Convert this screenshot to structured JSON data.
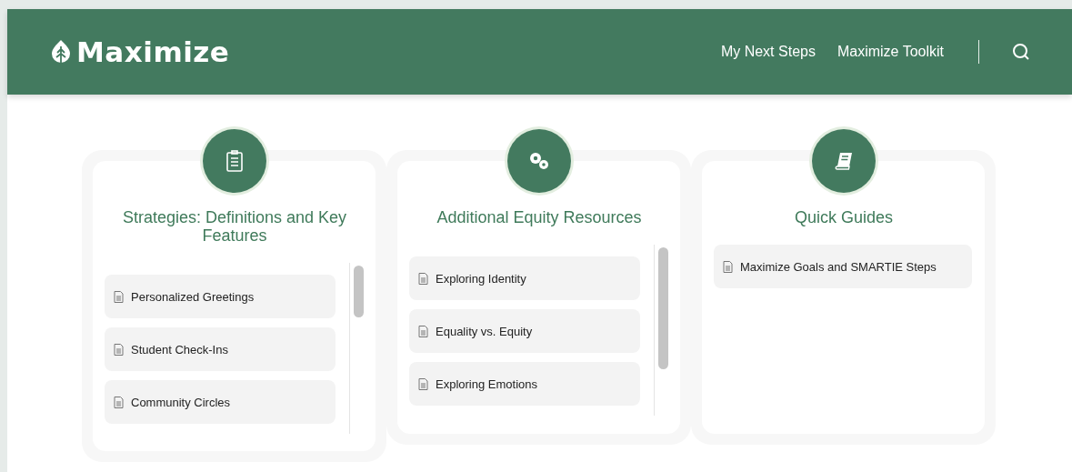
{
  "header": {
    "brand": "Maximize",
    "nav": [
      {
        "label": "My Next Steps"
      },
      {
        "label": "Maximize Toolkit"
      }
    ]
  },
  "cards": [
    {
      "title": "Strategies: Definitions and Key Features",
      "scrollable": true,
      "items": [
        "Personalized Greetings",
        "Student Check-Ins",
        "Community Circles"
      ]
    },
    {
      "title": "Additional Equity Resources",
      "scrollable": true,
      "items": [
        "Exploring Identity",
        "Equality vs. Equity",
        "Exploring Emotions"
      ]
    },
    {
      "title": "Quick Guides",
      "scrollable": false,
      "items": [
        "Maximize Goals and SMARTIE Steps"
      ]
    }
  ]
}
